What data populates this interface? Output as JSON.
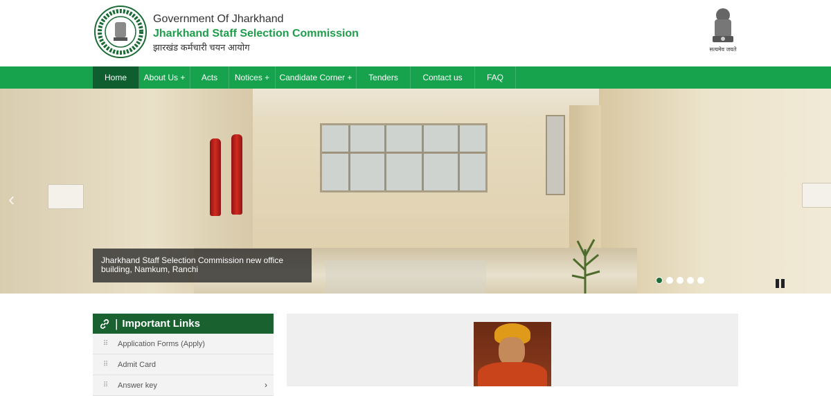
{
  "header": {
    "gov_line": "Government Of Jharkhand",
    "commission_name": "Jharkhand Staff Selection Commission",
    "hindi_name": "झारखंड कर्मचारी चयन आयोग",
    "emblem_motto": "सत्यमेव जयते"
  },
  "nav": {
    "items": [
      {
        "label": "Home",
        "active": true
      },
      {
        "label": "About Us +"
      },
      {
        "label": "Acts"
      },
      {
        "label": "Notices +"
      },
      {
        "label": "Candidate Corner +"
      },
      {
        "label": "Tenders"
      },
      {
        "label": "Contact us"
      },
      {
        "label": "FAQ"
      }
    ]
  },
  "slider": {
    "caption": "Jharkhand Staff Selection Commission new office building, Namkum, Ranchi",
    "slide_count": 5,
    "active_slide": 1
  },
  "important_links": {
    "title": "Important Links",
    "items": [
      {
        "label": "Application Forms (Apply)"
      },
      {
        "label": "Admit Card"
      },
      {
        "label": "Answer key"
      }
    ]
  },
  "colors": {
    "nav_green": "#17a24d",
    "nav_active": "#0f5e30",
    "brand_green": "#1e9e4a",
    "panel_head": "#1a6130"
  }
}
